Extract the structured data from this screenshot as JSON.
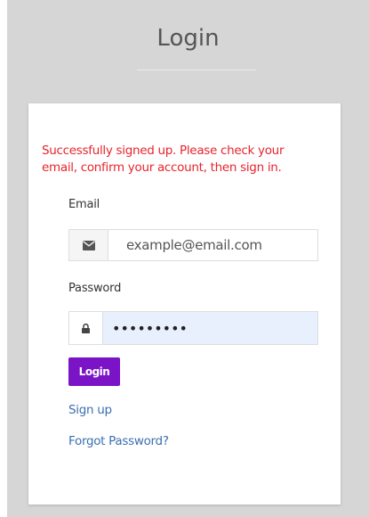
{
  "header": {
    "title": "Login"
  },
  "form": {
    "message": "Successfully signed up. Please check your email, confirm your account, then sign in.",
    "email_label": "Email",
    "email_placeholder": "example@email.com",
    "email_value": "",
    "email_icon": "envelope-icon",
    "password_label": "Password",
    "password_value": "•••••••••",
    "password_icon": "lock-icon",
    "login_label": "Login",
    "signup_label": "Sign up",
    "forgot_label": "Forgot Password?"
  },
  "colors": {
    "background": "#d6d6d6",
    "message": "#e8242c",
    "button": "#7a14c6",
    "link": "#3b6fb0",
    "autofill": "#e8f0fe"
  }
}
